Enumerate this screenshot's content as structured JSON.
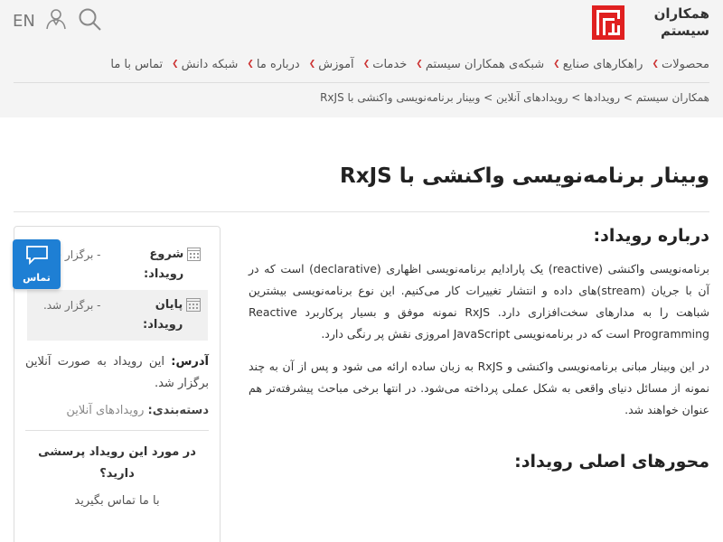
{
  "brand": {
    "line1": "همکاران",
    "line2": "سیستم"
  },
  "top": {
    "lang": "EN"
  },
  "nav": [
    {
      "label": "محصولات"
    },
    {
      "label": "راهکارهای صنایع"
    },
    {
      "label": "شبکه‌ی همکاران سیستم"
    },
    {
      "label": "خدمات"
    },
    {
      "label": "آموزش"
    },
    {
      "label": "درباره ما"
    },
    {
      "label": "شبکه دانش"
    },
    {
      "label": "تماس با ما"
    }
  ],
  "breadcrumb": "همکاران سیستم > رویدادها > رویدادهای آنلاین > وبینار برنامه‌نویسی واکنشی با RxJS",
  "page_title": "وبینار برنامه‌نویسی واکنشی با RxJS",
  "main": {
    "about_heading": "درباره رویداد:",
    "para1": "برنامه‌نویسی واکنشی (reactive) یک پارادایم برنامه‌نویسی اظهاری (declarative) است که در آن با جریان (stream)های داده و انتشار تغییرات کار می‌کنیم. این نوع برنامه‌نویسی بیشترین شباهت را به مدارهای سخت‌افزاری دارد. RxJS نمونه موفق و بسیار پرکاربرد Reactive Programming است که در برنامه‌نویسی JavaScript امروزی نقش پر رنگی دارد.",
    "para2": "در این وبینار مبانی برنامه‌نویسی واکنشی و RxJS به زبان ساده ارائه می شود و پس از آن به چند نمونه از مسائل دنیای واقعی به شکل عملی پرداخته می‌شود. در انتها برخی مباحث پیشرفته‌تر هم عنوان خواهند شد.",
    "topics_heading": "محورهای اصلی رویداد:"
  },
  "sidebar": {
    "start_label": "شروع رویداد:",
    "start_value": "- برگزار شد.",
    "end_label": "پایان رویداد:",
    "end_value": "- برگزار شد.",
    "address_label": "آدرس:",
    "address_value": "این رویداد به صورت آنلاین برگزار شد.",
    "category_label": "دسته‌بندی:",
    "category_value": "رویدادهای آنلاین",
    "question": "در مورد این رویداد پرسشی دارید؟",
    "contact_line": "با ما تماس بگیرید"
  },
  "contact_button": {
    "label": "تماس"
  },
  "colors": {
    "brand_red": "#e02020",
    "contact_blue": "#1e7fd4",
    "nav_chevron": "#cc3333"
  }
}
